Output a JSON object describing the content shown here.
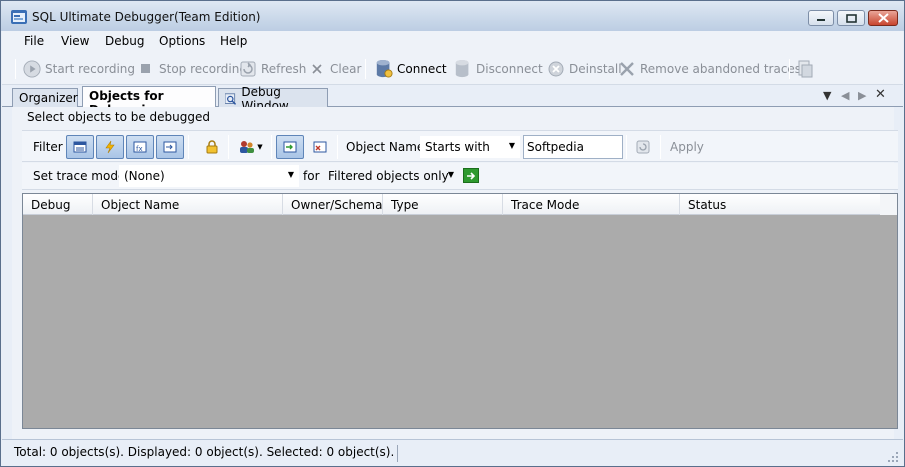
{
  "window": {
    "title": "SQL Ultimate Debugger(Team Edition)",
    "controls": [
      "minimize",
      "maximize",
      "close"
    ]
  },
  "menu": [
    "File",
    "View",
    "Debug",
    "Options",
    "Help"
  ],
  "toolbar": {
    "start_recording": "Start recording",
    "stop_recording": "Stop recording",
    "refresh": "Refresh",
    "clear": "Clear",
    "connect": "Connect",
    "disconnect": "Disconnect",
    "deinstall": "Deinstall",
    "remove_abandoned": "Remove abandoned traces"
  },
  "tabs": {
    "organizer": "Organizer",
    "objects_for_debugging": "Objects for Debugging",
    "debug_window": "Debug Window",
    "active": "Objects for Debugging"
  },
  "panel": {
    "caption": "Select objects to be debugged",
    "filter_label": "Filter",
    "object_name_label": "Object Name",
    "match_mode": "Starts with",
    "object_name_value": "Softpedia",
    "apply": "Apply",
    "set_trace_mode_label": "Set trace mode:",
    "trace_mode_value": "(None)",
    "for_label": "for",
    "scope_value": "Filtered objects only"
  },
  "grid": {
    "columns": [
      "Debug",
      "Object Name",
      "Owner/Schema",
      "Type",
      "Trace Mode",
      "Status"
    ],
    "rows": []
  },
  "status": {
    "text": "Total: 0 objects(s). Displayed: 0 object(s). Selected: 0 object(s)."
  },
  "colors": {
    "titlebar": "#cbd9ea",
    "grid_background": "#ababab",
    "close_button": "#c8452e",
    "apply_green": "#2f9a2f"
  },
  "icons": {
    "app": "database-debugger-icon",
    "start": "play-icon",
    "stop": "stop-icon",
    "refresh": "refresh-icon",
    "clear": "x-icon",
    "connect": "database-connect-icon",
    "disconnect": "database-disconnect-icon",
    "deinstall": "deinstall-icon",
    "remove": "remove-x-icon",
    "lock": "lock-icon",
    "users": "users-icon"
  }
}
